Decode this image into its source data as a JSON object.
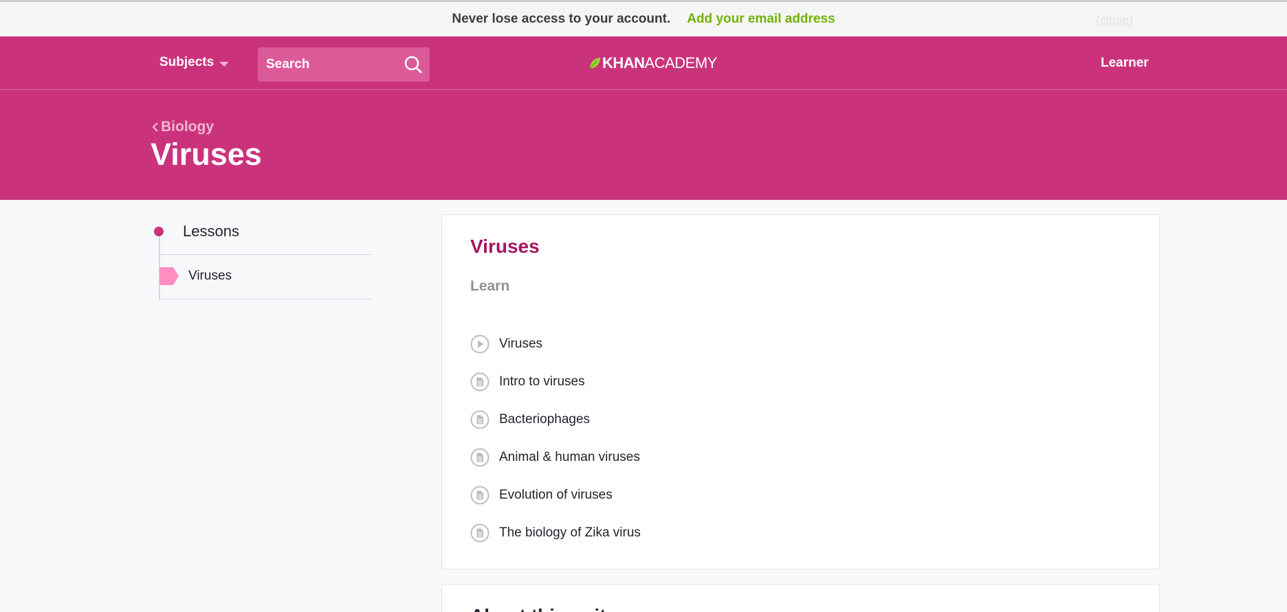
{
  "notice": {
    "message": "Never lose access to your account.",
    "link": "Add your email address",
    "close": "(close)"
  },
  "nav": {
    "subjects": "Subjects",
    "search_placeholder": "Search",
    "logo_bold": "KHAN",
    "logo_light": "ACADEMY",
    "user": "Learner"
  },
  "hero": {
    "breadcrumb": "Biology",
    "title": "Viruses"
  },
  "sidebar": {
    "heading": "Lessons",
    "items": [
      {
        "label": "Viruses"
      }
    ]
  },
  "main": {
    "title": "Viruses",
    "section": "Learn",
    "lessons": [
      {
        "label": "Viruses",
        "icon": "play-icon"
      },
      {
        "label": "Intro to viruses",
        "icon": "article-icon"
      },
      {
        "label": "Bacteriophages",
        "icon": "article-icon"
      },
      {
        "label": "Animal & human viruses",
        "icon": "article-icon"
      },
      {
        "label": "Evolution of viruses",
        "icon": "article-icon"
      },
      {
        "label": "The biology of Zika virus",
        "icon": "article-icon"
      }
    ]
  },
  "about": {
    "title": "About this unit"
  },
  "colors": {
    "brand": "#ca337c",
    "title_accent": "#a4155f",
    "link_green": "#71b307"
  }
}
